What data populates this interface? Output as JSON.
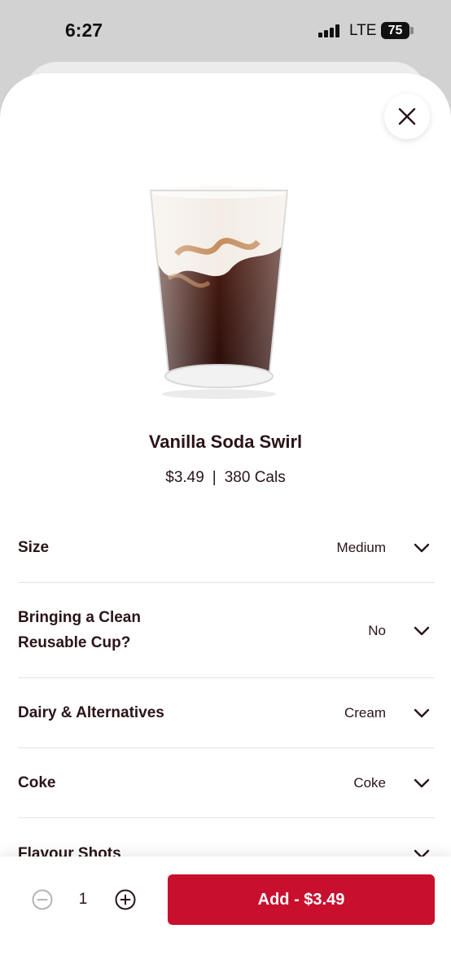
{
  "status_bar": {
    "time": "6:27",
    "network": "LTE",
    "battery": "75"
  },
  "product": {
    "name": "Vanilla Soda Swirl",
    "price": "$3.49",
    "calories": "380 Cals",
    "separator": "|"
  },
  "options": [
    {
      "label": "Size",
      "value": "Medium"
    },
    {
      "label": "Bringing a Clean\nReusable Cup?",
      "value": "No"
    },
    {
      "label": "Dairy & Alternatives",
      "value": "Cream"
    },
    {
      "label": "Coke",
      "value": "Coke"
    },
    {
      "label": "Flavour Shots",
      "value": ""
    }
  ],
  "footer": {
    "quantity": "1",
    "add_label": "Add - $3.49"
  },
  "colors": {
    "brand_red": "#c8102e",
    "text": "#2a1418",
    "divider": "#e7e2e2"
  },
  "icons": [
    "close-icon",
    "chevron-down-icon",
    "minus-circle-icon",
    "plus-circle-icon",
    "signal-icon",
    "battery-icon"
  ]
}
